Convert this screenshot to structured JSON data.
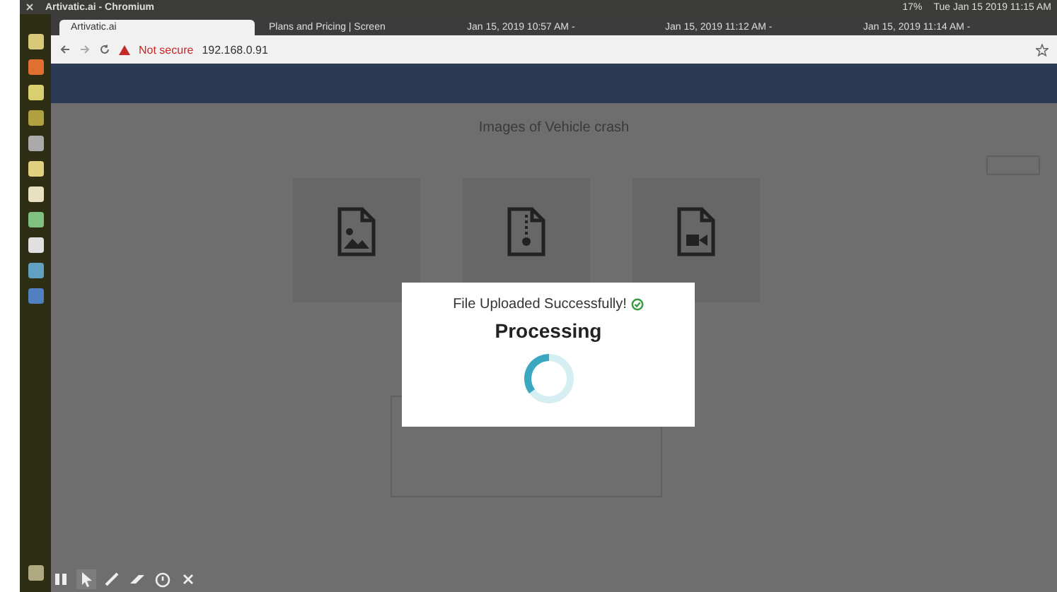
{
  "system_bar": {
    "window_title": "Artivatic.ai - Chromium",
    "battery": "17%",
    "clock": "Tue Jan 15 2019 11:15 AM"
  },
  "tabs": [
    {
      "label": "Artivatic.ai",
      "selected": true
    },
    {
      "label": "Plans and Pricing | Screen",
      "selected": false
    },
    {
      "label": "Jan 15, 2019 10:57 AM -",
      "selected": false
    },
    {
      "label": "Jan 15, 2019 11:12 AM -",
      "selected": false
    },
    {
      "label": "Jan 15, 2019 11:14 AM -",
      "selected": false
    }
  ],
  "address_bar": {
    "security": "Not secure",
    "url": "192.168.0.91"
  },
  "page": {
    "heading": "Images of Vehicle crash",
    "cards": [
      {
        "kind": "image"
      },
      {
        "kind": "zip"
      },
      {
        "kind": "video"
      }
    ]
  },
  "dialog": {
    "message": "File Uploaded Successfully!",
    "title": "Processing"
  }
}
